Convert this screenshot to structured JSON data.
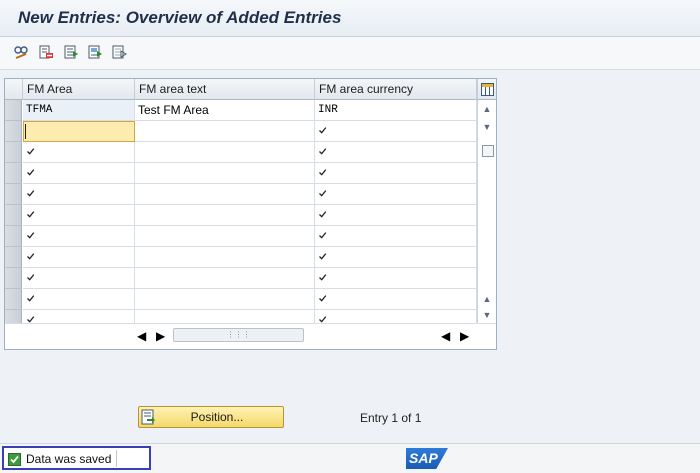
{
  "window": {
    "title": "New Entries: Overview of Added Entries"
  },
  "toolbar": {
    "buttons": [
      {
        "name": "display-change-icon"
      },
      {
        "name": "delete-icon"
      },
      {
        "name": "select-all-icon"
      },
      {
        "name": "select-block-icon"
      },
      {
        "name": "deselect-all-icon"
      }
    ]
  },
  "table": {
    "columns": [
      "FM Area",
      "FM area text",
      "FM area currency"
    ],
    "rows": [
      {
        "fm_area": "TFMA",
        "fm_area_text": "Test FM Area",
        "currency": "INR"
      },
      {
        "fm_area": "",
        "fm_area_text": "",
        "currency": "checked",
        "active": true
      },
      {
        "fm_area": "checked",
        "fm_area_text": "",
        "currency": "checked"
      },
      {
        "fm_area": "checked",
        "fm_area_text": "",
        "currency": "checked"
      },
      {
        "fm_area": "checked",
        "fm_area_text": "",
        "currency": "checked"
      },
      {
        "fm_area": "checked",
        "fm_area_text": "",
        "currency": "checked"
      },
      {
        "fm_area": "checked",
        "fm_area_text": "",
        "currency": "checked"
      },
      {
        "fm_area": "checked",
        "fm_area_text": "",
        "currency": "checked"
      },
      {
        "fm_area": "checked",
        "fm_area_text": "",
        "currency": "checked"
      },
      {
        "fm_area": "checked",
        "fm_area_text": "",
        "currency": "checked"
      },
      {
        "fm_area": "checked",
        "fm_area_text": "",
        "currency": "checked"
      }
    ]
  },
  "footer": {
    "position_button": "Position...",
    "entry_info": "Entry 1 of 1"
  },
  "status": {
    "message": "Data was saved",
    "type": "success"
  },
  "branding": {
    "logo": "SAP"
  },
  "colors": {
    "accent": "#1a5bb3",
    "active_input": "#fdecb0",
    "success": "#3c9b3c",
    "button": "#f4d86a"
  }
}
